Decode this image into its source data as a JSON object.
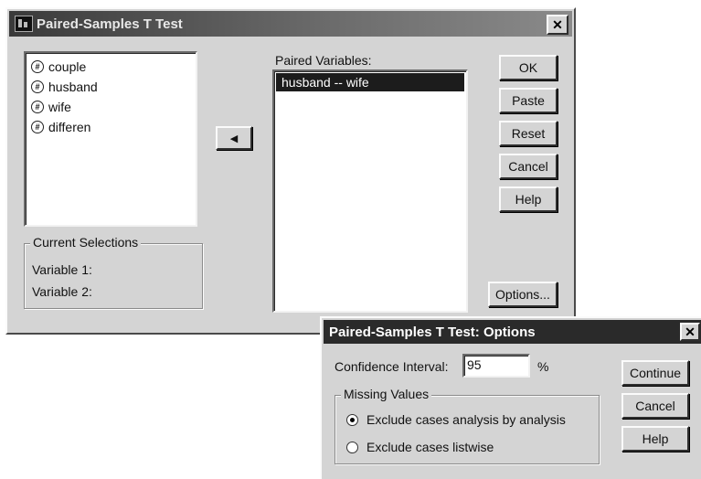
{
  "main_dialog": {
    "title": "Paired-Samples T Test",
    "close_glyph": "✕",
    "variables": [
      {
        "icon": "#",
        "label": "couple"
      },
      {
        "icon": "#",
        "label": "husband"
      },
      {
        "icon": "#",
        "label": "wife"
      },
      {
        "icon": "#",
        "label": "differen"
      }
    ],
    "move_button_glyph": "◀",
    "paired_label": "Paired Variables:",
    "paired_items": [
      "husband -- wife"
    ],
    "buttons": {
      "ok": "OK",
      "paste": "Paste",
      "reset": "Reset",
      "cancel": "Cancel",
      "help": "Help",
      "options": "Options..."
    },
    "current_selections": {
      "legend": "Current Selections",
      "var1": "Variable 1:",
      "var2": "Variable 2:"
    }
  },
  "options_dialog": {
    "title": "Paired-Samples T Test: Options",
    "close_glyph": "✕",
    "ci_label": "Confidence Interval:",
    "ci_value": "95",
    "ci_unit": "%",
    "missing_legend": "Missing Values",
    "radio_analysis": "Exclude cases analysis by analysis",
    "radio_listwise": "Exclude cases listwise",
    "selected_radio": "analysis",
    "buttons": {
      "continue": "Continue",
      "cancel": "Cancel",
      "help": "Help"
    }
  }
}
